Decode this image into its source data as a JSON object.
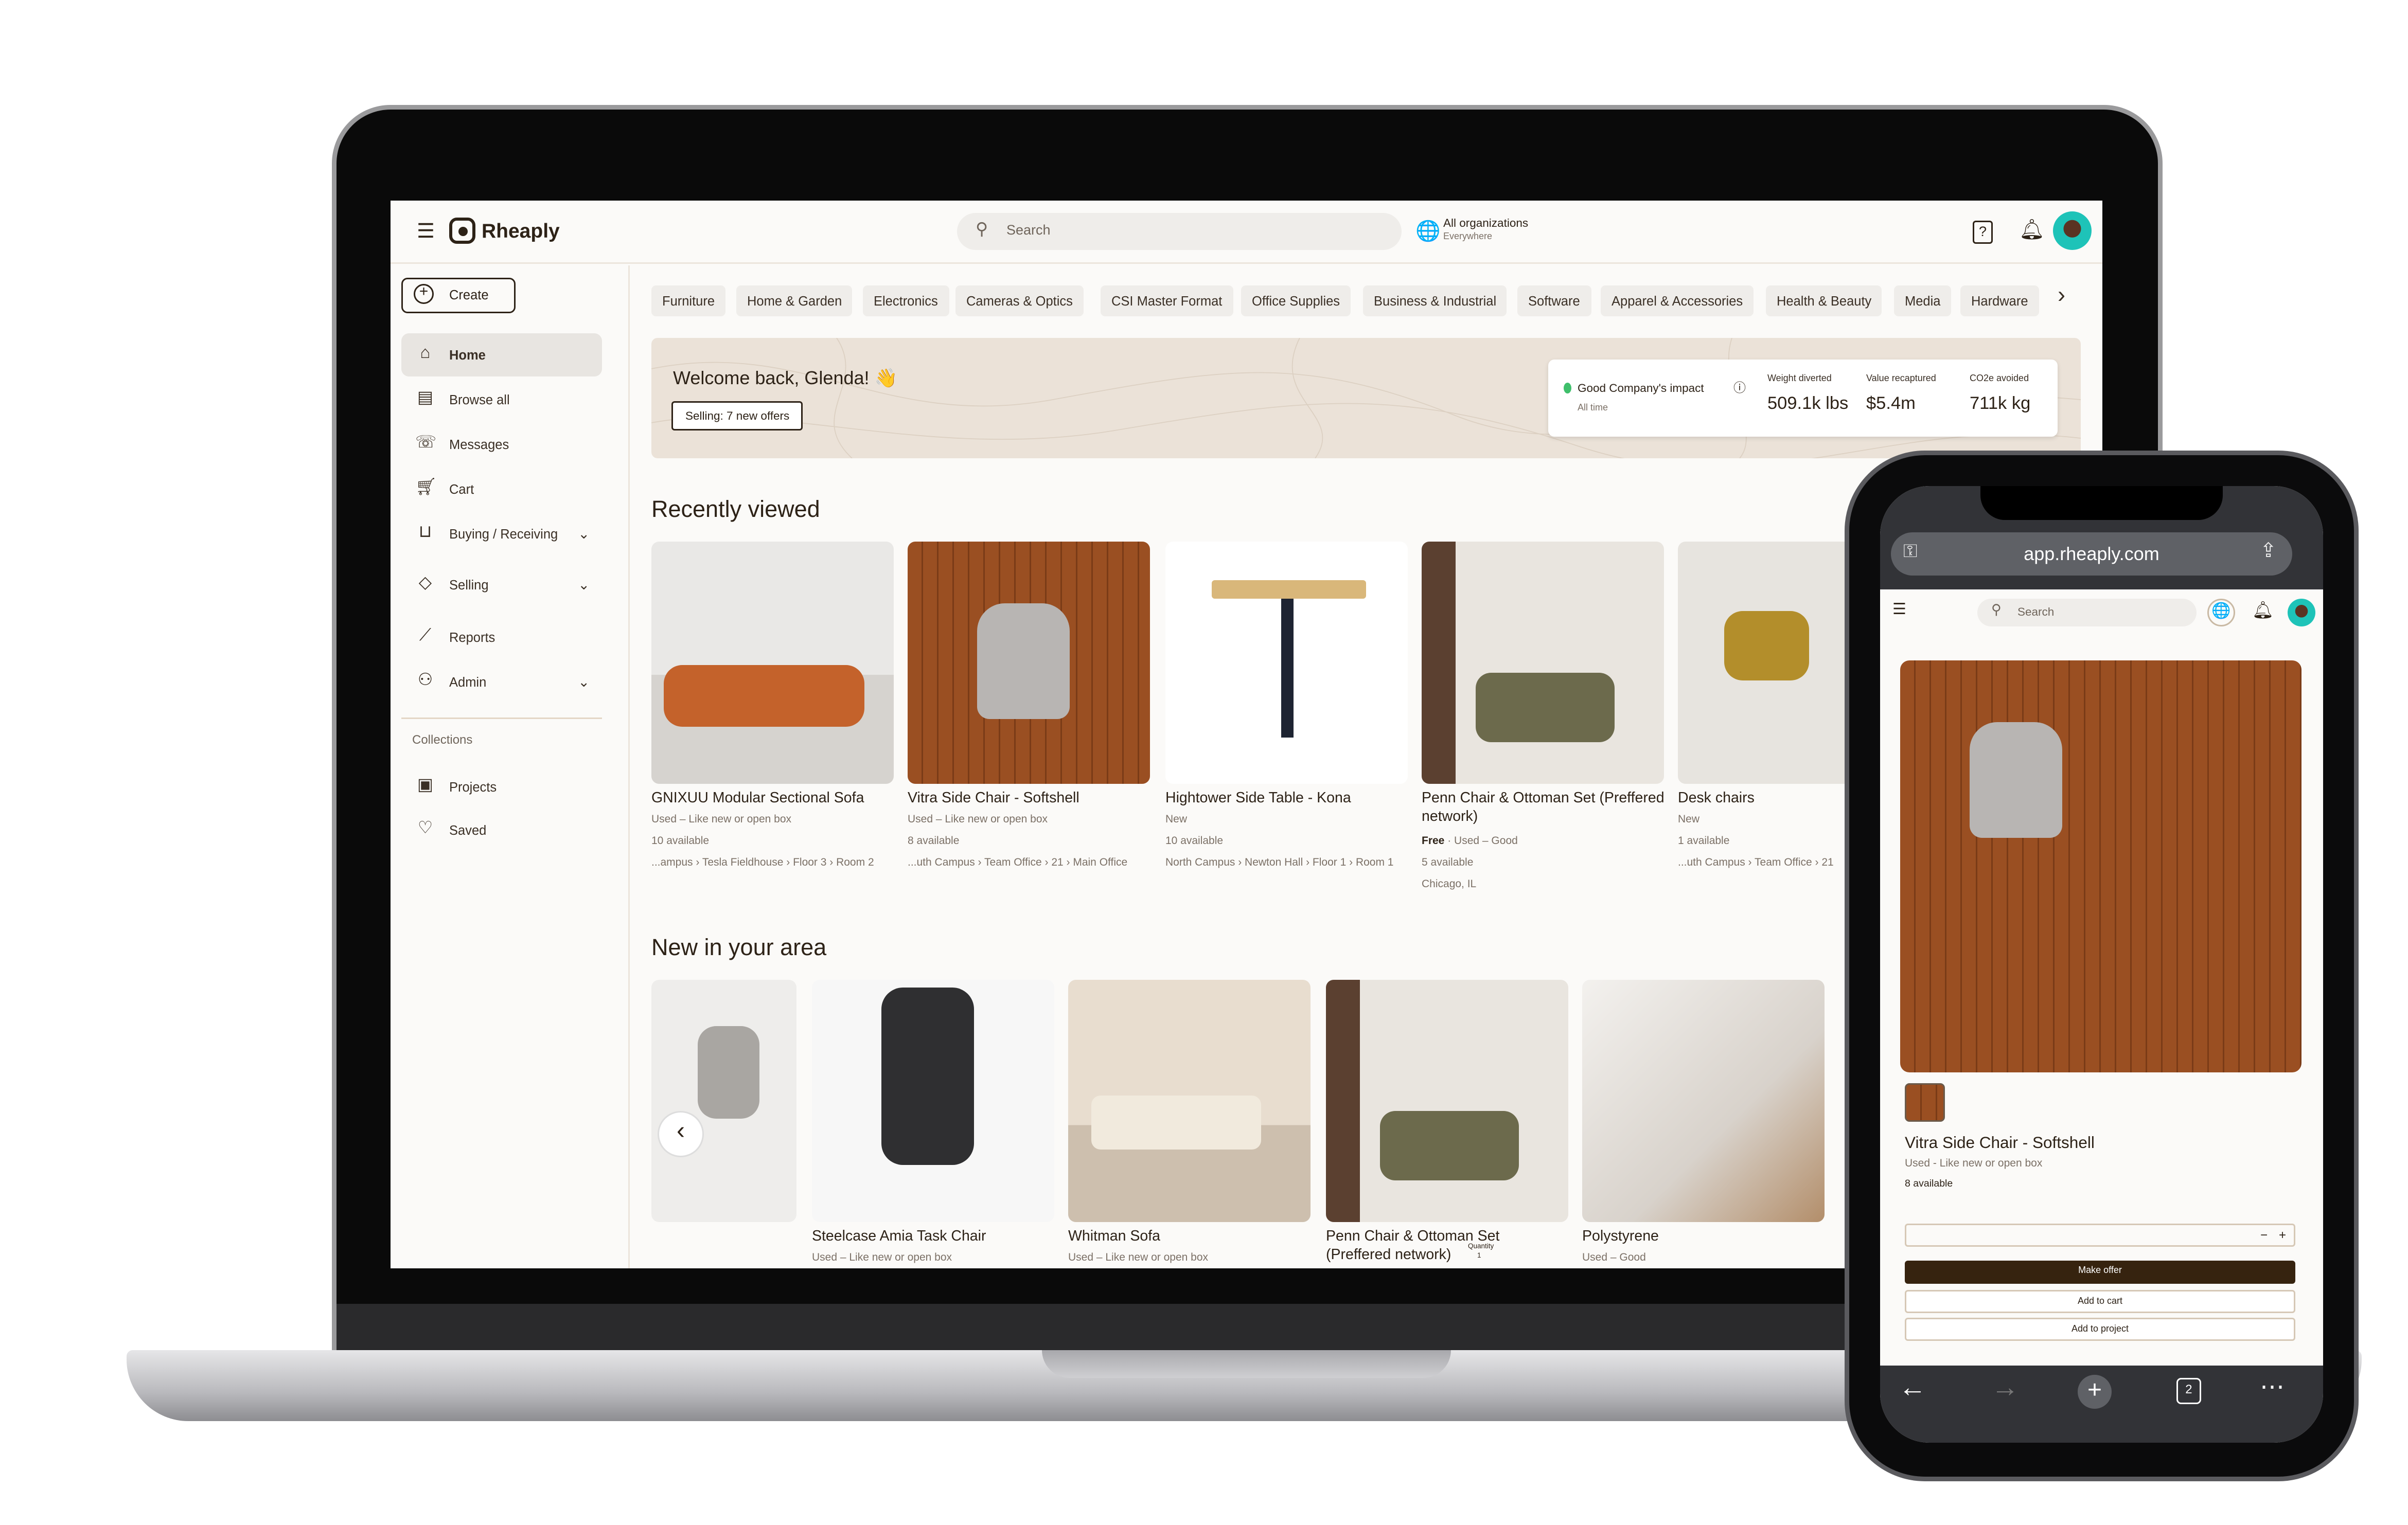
{
  "app": {
    "brand": "Rheaply",
    "search_placeholder": "Search",
    "org": {
      "name": "All organizations",
      "location": "Everywhere"
    },
    "help_label": "?"
  },
  "sidebar": {
    "create_label": "Create",
    "items": [
      {
        "label": "Home",
        "icon": "home-icon",
        "active": true
      },
      {
        "label": "Browse all",
        "icon": "storefront-icon"
      },
      {
        "label": "Messages",
        "icon": "chat-icon"
      },
      {
        "label": "Cart",
        "icon": "cart-icon"
      },
      {
        "label": "Buying / Receiving",
        "icon": "basket-icon",
        "expandable": true
      },
      {
        "label": "Selling",
        "icon": "tag-icon",
        "expandable": true
      },
      {
        "label": "Reports",
        "icon": "chart-icon"
      },
      {
        "label": "Admin",
        "icon": "user-gear-icon",
        "expandable": true
      }
    ],
    "collections_heading": "Collections",
    "collections": [
      {
        "label": "Projects",
        "icon": "project-icon"
      },
      {
        "label": "Saved",
        "icon": "heart-icon"
      }
    ]
  },
  "categories": [
    "Furniture",
    "Home & Garden",
    "Electronics",
    "Cameras & Optics",
    "CSI Master Format",
    "Office Supplies",
    "Business & Industrial",
    "Software",
    "Apparel & Accessories",
    "Health & Beauty",
    "Media",
    "Hardware"
  ],
  "banner": {
    "welcome": "Welcome back, Glenda! 👋",
    "selling_button": "Selling: 7 new offers",
    "impact": {
      "title": "Good Company's impact",
      "period": "All time",
      "metrics": [
        {
          "label": "Weight diverted",
          "value": "509.1k lbs"
        },
        {
          "label": "Value recaptured",
          "value": "$5.4m"
        },
        {
          "label": "CO2e avoided",
          "value": "711k kg"
        }
      ]
    }
  },
  "recently_viewed": {
    "title": "Recently viewed",
    "items": [
      {
        "title": "GNIXUU Modular Sectional Sofa",
        "lines": [
          "Used – Like new or open box",
          "10 available",
          "...ampus › Tesla Fieldhouse › Floor 3 › Room 2"
        ]
      },
      {
        "title": "Vitra Side Chair - Softshell",
        "lines": [
          "Used – Like new or open box",
          "8 available",
          "...uth Campus › Team Office › 21 › Main Office"
        ]
      },
      {
        "title": "Hightower Side Table - Kona",
        "lines": [
          "New",
          "10 available",
          "North Campus › Newton Hall › Floor 1 › Room 1"
        ]
      },
      {
        "title": "Penn Chair & Ottoman Set (Preffered network)",
        "price": "Free",
        "lines": [
          "Used – Good",
          "5 available",
          "Chicago, IL"
        ]
      },
      {
        "title": "Desk chairs",
        "lines": [
          "New",
          "1 available",
          "...uth Campus › Team Office › 21"
        ]
      }
    ]
  },
  "new_in_area": {
    "title": "New in your area",
    "items": [
      {
        "title": "",
        "lines": []
      },
      {
        "title": "Steelcase Amia Task Chair",
        "lines": [
          "Used – Like new or open box"
        ]
      },
      {
        "title": "Whitman Sofa",
        "lines": [
          "Used – Like new or open box"
        ]
      },
      {
        "title": "Penn Chair & Ottoman Set (Preffered network)",
        "lines": [],
        "quantity_label": "Quantity",
        "quantity": "1"
      },
      {
        "title": "Polystyrene",
        "lines": [
          "Used – Good"
        ]
      }
    ]
  },
  "phone": {
    "url": "app.rheaply.com",
    "search_placeholder": "Search",
    "product": {
      "title": "Vitra Side Chair - Softshell",
      "condition": "Used - Like new or open box",
      "available": "8 available",
      "make_offer": "Make offer",
      "add_to_cart": "Add to cart",
      "add_to_project": "Add to project",
      "minus": "−",
      "plus": "+"
    },
    "tab_count": "2"
  },
  "colors": {
    "primary": "#36230f",
    "banner": "#ebe2d8",
    "accent_green": "#3fbf6b"
  }
}
